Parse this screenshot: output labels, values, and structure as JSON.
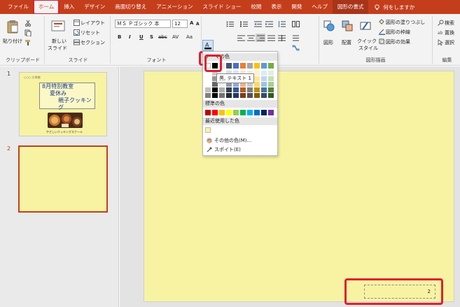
{
  "tabs": [
    {
      "label": "ファイル"
    },
    {
      "label": "ホーム",
      "active": true
    },
    {
      "label": "挿入"
    },
    {
      "label": "デザイン"
    },
    {
      "label": "画面切り替え"
    },
    {
      "label": "アニメーション"
    },
    {
      "label": "スライド ショー"
    },
    {
      "label": "校閲"
    },
    {
      "label": "表示"
    },
    {
      "label": "開発"
    },
    {
      "label": "ヘルプ"
    },
    {
      "label": "図形の書式",
      "contextual": true
    }
  ],
  "tell_me": "何をしますか",
  "ribbon": {
    "clipboard": {
      "label": "クリップボード",
      "paste": "貼り付け"
    },
    "slides": {
      "label": "スライド",
      "new_slide": "新しい",
      "new_slide2": "スライド",
      "layout": "レイアウト",
      "reset": "リセット",
      "section": "セクション"
    },
    "font": {
      "label": "フォント",
      "font_name": "ＭＳ Ｐゴシック 本",
      "font_size": "12",
      "bold": "B",
      "italic": "I",
      "underline": "U",
      "shadow": "S",
      "strike": "abc",
      "spacing": "AV",
      "case": "Aa",
      "grow": "A",
      "shrink": "A"
    },
    "paragraph": {
      "label": ""
    },
    "drawing": {
      "label": "図形描画",
      "shapes": "図形",
      "arrange": "配置",
      "quick_styles": "クイック",
      "quick_styles2": "スタイル",
      "fill": "図形の塗りつぶし",
      "outline": "図形の枠線",
      "effects": "図形の効果"
    },
    "editing": {
      "label": "編集",
      "find": "検索",
      "replace": "置換",
      "select": "選択"
    }
  },
  "thumbnails": [
    {
      "number": "1",
      "header_small": "○○○ 小学校",
      "title1": "8月特別教室",
      "title2": "夏休み",
      "title3": "親子クッキング",
      "footer": "やさしいクッキングスクール"
    },
    {
      "number": "2"
    }
  ],
  "slide_number_box": "2",
  "dropdown": {
    "theme_header": "テーマの色",
    "tooltip": "黒, テキスト 1",
    "standard_header": "標準の色",
    "recent_header": "最近使用した色",
    "more_colors": "その他の色(M)...",
    "eyedropper": "スポイト(E)"
  },
  "colors": {
    "accent": "#c43e1c",
    "highlight": "#e0202c",
    "slide_bg": "#f7f3a3",
    "recent_color": "#f7f3a3",
    "theme_row": [
      "#ffffff",
      "#000000",
      "#e7e6e6",
      "#44546a",
      "#4472c4",
      "#ed7d31",
      "#a5a5a5",
      "#ffc000",
      "#5b9bd5",
      "#70ad47"
    ],
    "standard_row": [
      "#c00000",
      "#ff0000",
      "#ffc000",
      "#ffff00",
      "#92d050",
      "#00b050",
      "#00b0f0",
      "#0070c0",
      "#002060",
      "#7030a0"
    ]
  }
}
